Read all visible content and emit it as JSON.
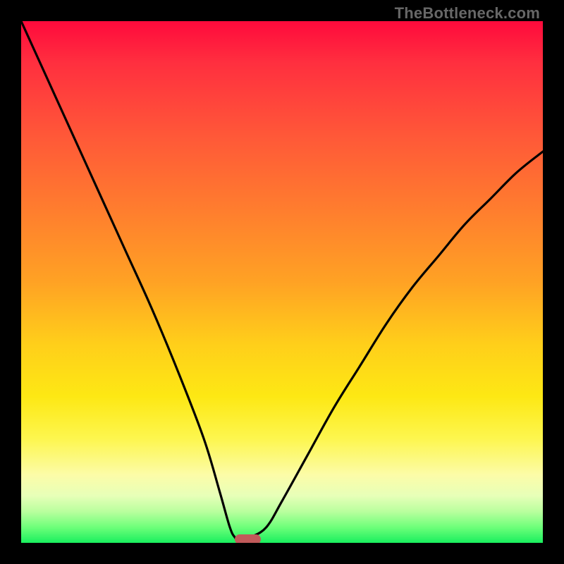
{
  "watermark": {
    "text": "TheBottleneck.com"
  },
  "chart_data": {
    "type": "line",
    "title": "",
    "xlabel": "",
    "ylabel": "",
    "xlim": [
      0,
      100
    ],
    "ylim": [
      0,
      100
    ],
    "grid": false,
    "legend": false,
    "series": [
      {
        "name": "curve",
        "x": [
          0,
          5,
          10,
          15,
          20,
          25,
          30,
          35,
          38,
          40,
          41,
          42,
          43,
          44,
          47,
          50,
          55,
          60,
          65,
          70,
          75,
          80,
          85,
          90,
          95,
          100
        ],
        "values": [
          100,
          89,
          78,
          67,
          56,
          45,
          33,
          20,
          10,
          3,
          1,
          0,
          0,
          1,
          3,
          8,
          17,
          26,
          34,
          42,
          49,
          55,
          61,
          66,
          71,
          75
        ]
      }
    ],
    "minimum_marker": {
      "x_start": 41,
      "x_end": 46,
      "y": 0
    },
    "gradient": {
      "stops": [
        {
          "pos": 0,
          "color": "#ff0a3c"
        },
        {
          "pos": 35,
          "color": "#ff7a2f"
        },
        {
          "pos": 62,
          "color": "#ffcf1a"
        },
        {
          "pos": 87,
          "color": "#fcfca8"
        },
        {
          "pos": 100,
          "color": "#19ef5e"
        }
      ]
    }
  }
}
